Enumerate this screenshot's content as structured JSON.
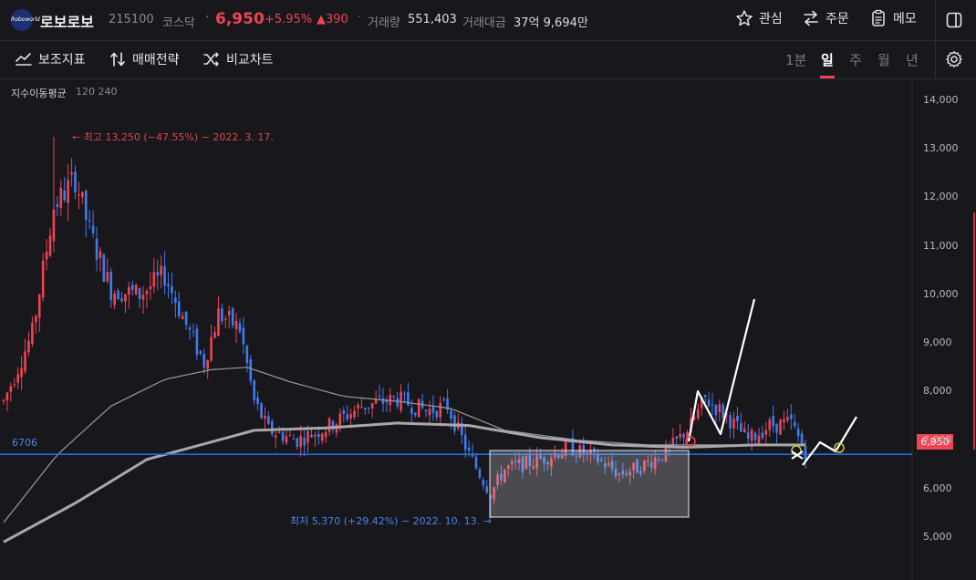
{
  "header": {
    "logo_text": "Roboworld",
    "name": "로보로보",
    "code": "215100",
    "market": "코스닥",
    "separator": "·",
    "price": "6,950",
    "change_rate": "+5.95%",
    "change_amount": "▲390",
    "volume_label": "거래량",
    "volume_value": "551,403",
    "amount_label": "거래대금",
    "amount_value": "37억 9,694만",
    "watch_label": "관심",
    "order_label": "주문",
    "memo_label": "메모"
  },
  "toolbar": {
    "indicator_label": "보조지표",
    "strategy_label": "매매전략",
    "compare_label": "비교차트",
    "periods": [
      "1분",
      "일",
      "주",
      "월",
      "년"
    ],
    "active_period": "일"
  },
  "colors": {
    "up": "#f04452",
    "down": "#3f7cf0",
    "level_line": "#1f6fe5",
    "background": "#17171c"
  },
  "chart_data": {
    "type": "candlestick",
    "indicator_label": "지수이동평균",
    "indicator_params": "120 240",
    "y_ticks": [
      "14,000",
      "13,000",
      "12,000",
      "11,000",
      "10,000",
      "9,000",
      "8,000",
      "7,000",
      "6,000",
      "5,000"
    ],
    "ylim": [
      4000,
      14500
    ],
    "current_price": 6950,
    "current_price_label": "6,950",
    "horizontal_level": 6706,
    "horizontal_level_label": "6706",
    "high_annotation": "← 최고 13,250 (−47.55%) − 2022. 3. 17.",
    "low_annotation": "최저 5,370 (+29.42%) − 2022. 10. 13. →",
    "high_value": 13250,
    "low_value": 5370,
    "trend_shape": [
      [
        0,
        7800
      ],
      [
        8,
        9200
      ],
      [
        14,
        11800
      ],
      [
        20,
        12400
      ],
      [
        24,
        11300
      ],
      [
        30,
        10100
      ],
      [
        38,
        10000
      ],
      [
        45,
        10400
      ],
      [
        52,
        9200
      ],
      [
        56,
        8600
      ],
      [
        60,
        9600
      ],
      [
        66,
        9300
      ],
      [
        70,
        7800
      ],
      [
        74,
        7200
      ],
      [
        82,
        7000
      ],
      [
        90,
        7250
      ],
      [
        100,
        7700
      ],
      [
        110,
        7850
      ],
      [
        118,
        7600
      ],
      [
        124,
        7700
      ],
      [
        130,
        6700
      ],
      [
        136,
        5900
      ],
      [
        140,
        6400
      ],
      [
        150,
        6600
      ],
      [
        158,
        6850
      ],
      [
        166,
        6600
      ],
      [
        172,
        6300
      ],
      [
        178,
        6450
      ],
      [
        186,
        6800
      ],
      [
        192,
        7300
      ],
      [
        196,
        7850
      ],
      [
        202,
        7500
      ],
      [
        208,
        7000
      ],
      [
        214,
        7300
      ],
      [
        220,
        7350
      ],
      [
        224,
        6750
      ]
    ],
    "ema_long": [
      [
        0,
        4900
      ],
      [
        20,
        5700
      ],
      [
        40,
        6600
      ],
      [
        60,
        7000
      ],
      [
        70,
        7200
      ],
      [
        90,
        7250
      ],
      [
        110,
        7350
      ],
      [
        130,
        7300
      ],
      [
        150,
        7050
      ],
      [
        170,
        6900
      ],
      [
        190,
        6850
      ],
      [
        210,
        6900
      ],
      [
        224,
        6900
      ]
    ],
    "ema_short": [
      [
        0,
        5300
      ],
      [
        15,
        6700
      ],
      [
        30,
        7700
      ],
      [
        45,
        8250
      ],
      [
        58,
        8450
      ],
      [
        68,
        8500
      ],
      [
        80,
        8200
      ],
      [
        95,
        7900
      ],
      [
        110,
        7800
      ],
      [
        125,
        7650
      ],
      [
        140,
        7200
      ],
      [
        160,
        7000
      ],
      [
        180,
        6900
      ],
      [
        200,
        6900
      ],
      [
        224,
        6900
      ]
    ]
  }
}
